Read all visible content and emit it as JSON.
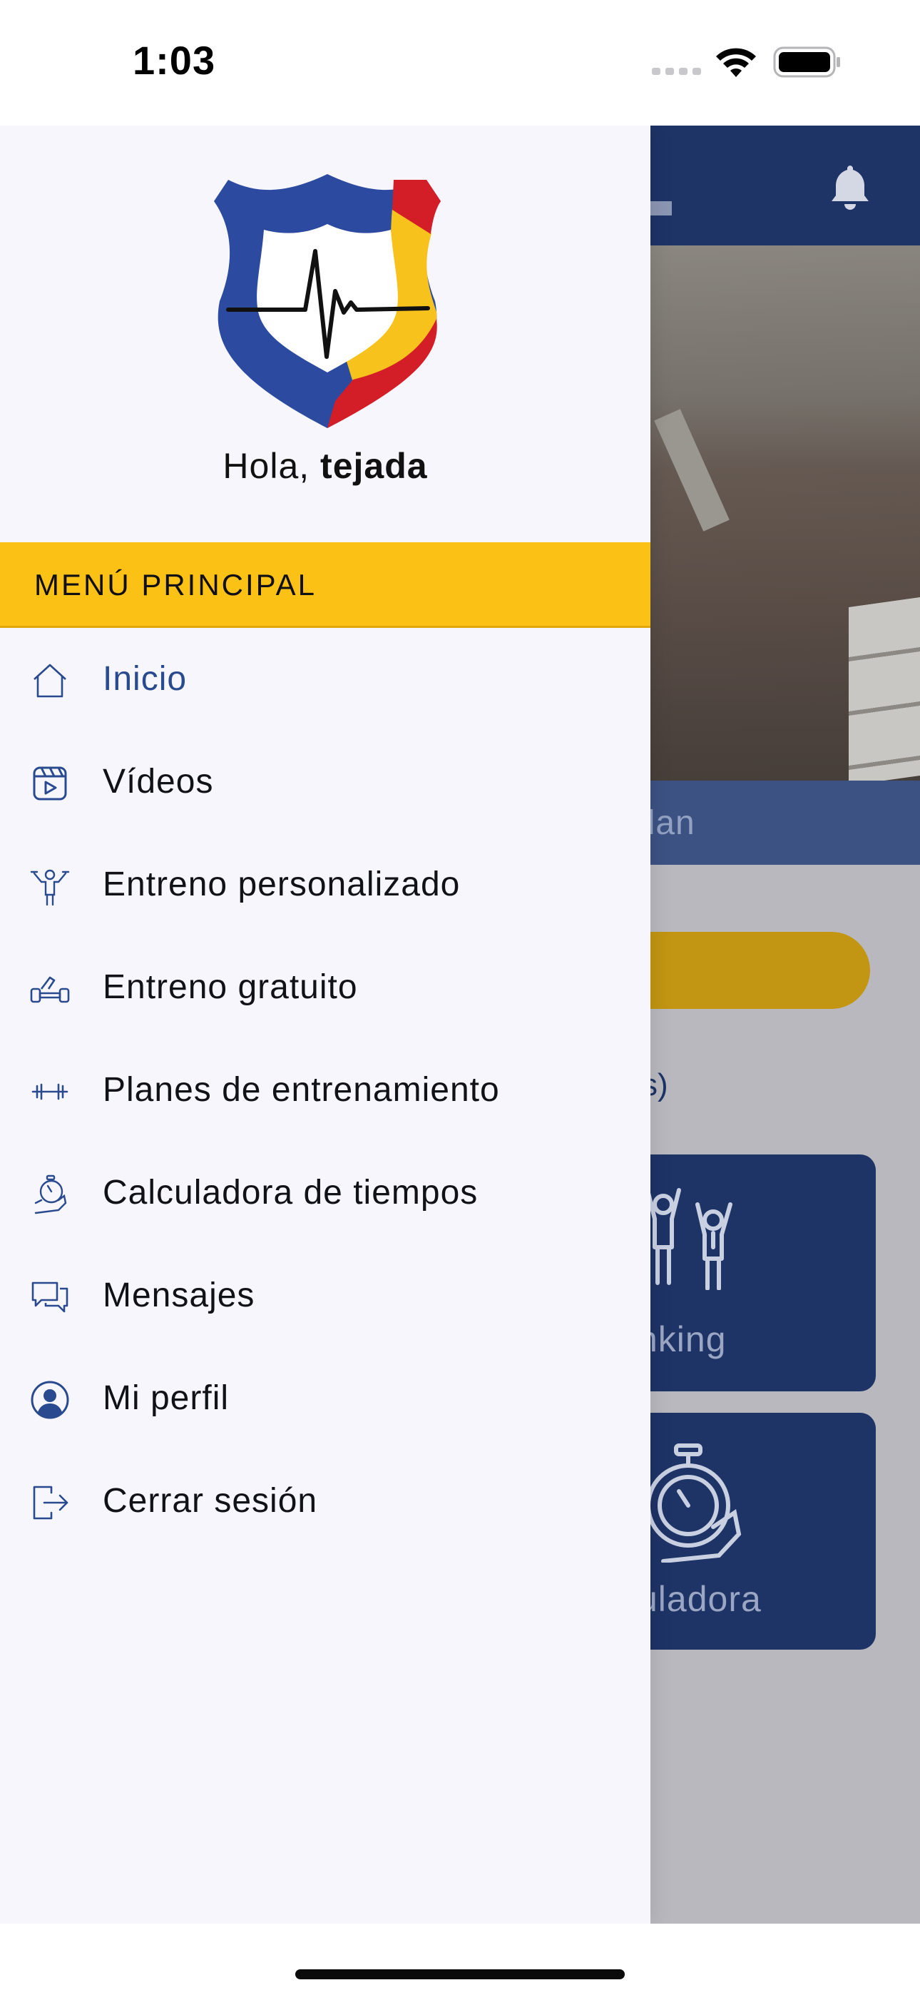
{
  "status_bar": {
    "time": "1:03",
    "icons": [
      "signal-icon",
      "wifi-icon",
      "battery-icon"
    ]
  },
  "drawer": {
    "logo": "shield-heartbeat-logo",
    "greeting_prefix": "Hola, ",
    "user_name": "tejada",
    "section_title": "MENÚ PRINCIPAL",
    "items": [
      {
        "label": "Inicio",
        "icon": "home-icon",
        "active": true
      },
      {
        "label": "Vídeos",
        "icon": "video-icon"
      },
      {
        "label": "Entreno personalizado",
        "icon": "athlete-icon"
      },
      {
        "label": "Entreno gratuito",
        "icon": "dumbbell-free-icon"
      },
      {
        "label": "Planes de entrenamiento",
        "icon": "dumbbell-icon"
      },
      {
        "label": "Calculadora de tiempos",
        "icon": "stopwatch-hand-icon"
      },
      {
        "label": "Mensajes",
        "icon": "messages-icon"
      },
      {
        "label": "Mi perfil",
        "icon": "profile-icon"
      },
      {
        "label": "Cerrar sesión",
        "icon": "logout-icon"
      }
    ]
  },
  "background_app": {
    "plan_text": "plan",
    "partial_text": "s)",
    "tile_1_label": "nking",
    "tile_2_label": "uladora",
    "icons": [
      "bell-icon",
      "ranking-icon",
      "stopwatch-icon"
    ]
  },
  "colors": {
    "brand_blue": "#1e3366",
    "accent_yellow": "#fbc114",
    "active_blue": "#2a4a8f",
    "drawer_bg": "#f7f6fc"
  }
}
